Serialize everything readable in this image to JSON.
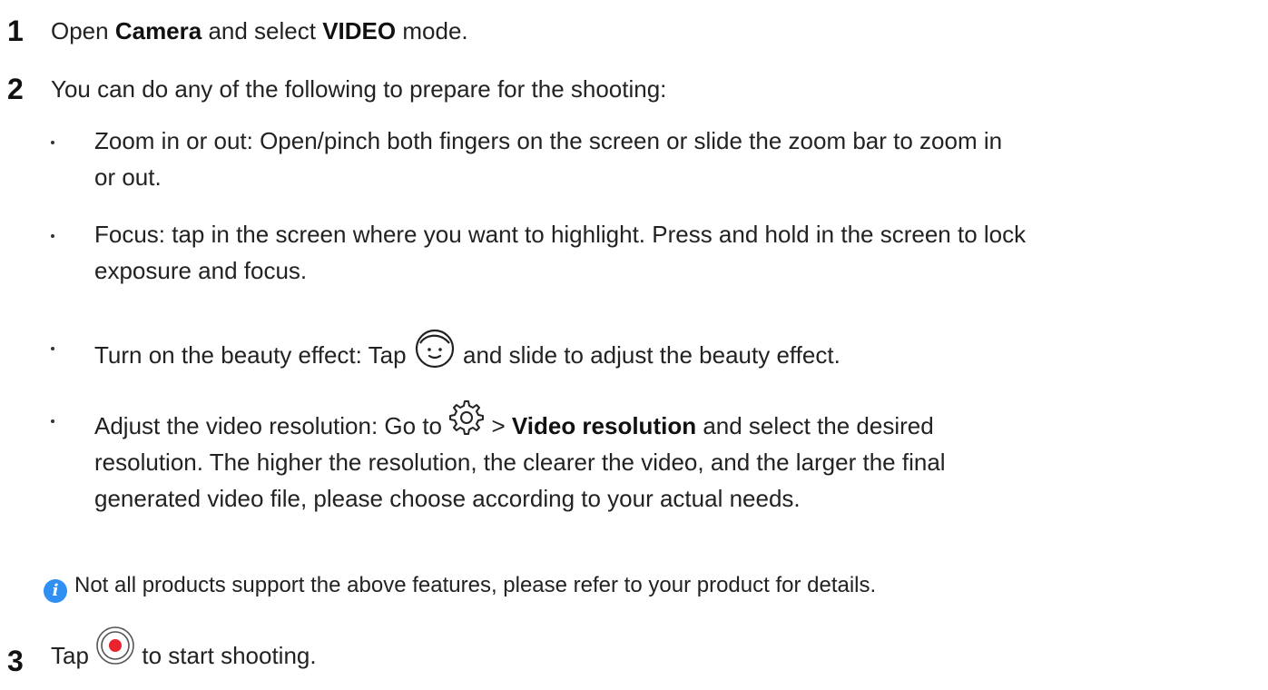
{
  "steps": [
    {
      "number": "1",
      "parts": [
        "Open ",
        "Camera",
        " and select ",
        "VIDEO",
        " mode."
      ]
    },
    {
      "number": "2",
      "intro": "You can do any of the following to prepare for the shooting:",
      "bullets": [
        {
          "lines": [
            "Zoom in or out: Open/pinch both fingers on the screen or slide the zoom bar to zoom in",
            "or out."
          ]
        },
        {
          "lines": [
            "Focus: tap in the screen where you want to highlight. Press and hold in the screen to lock",
            "exposure and focus."
          ]
        },
        {
          "before": "Turn on the beauty effect: Tap ",
          "icon": "beauty-face-icon",
          "after": " and slide to adjust the beauty effect."
        },
        {
          "before": "Adjust the video resolution: Go to ",
          "icon": "settings-gear-icon",
          "middle": " > ",
          "bold": "Video resolution",
          "after": " and select the desired",
          "lines": [
            "resolution. The higher the resolution, the clearer the video, and the larger the final",
            "generated video file, please choose according to your actual needs."
          ]
        }
      ],
      "note": "Not all products support the above features, please refer to your product for details."
    },
    {
      "number": "3",
      "before": "Tap ",
      "icon": "record-button-icon",
      "after": " to start shooting."
    }
  ],
  "colors": {
    "info_icon": "#2f8ff2",
    "record_dot": "#e8232b"
  }
}
